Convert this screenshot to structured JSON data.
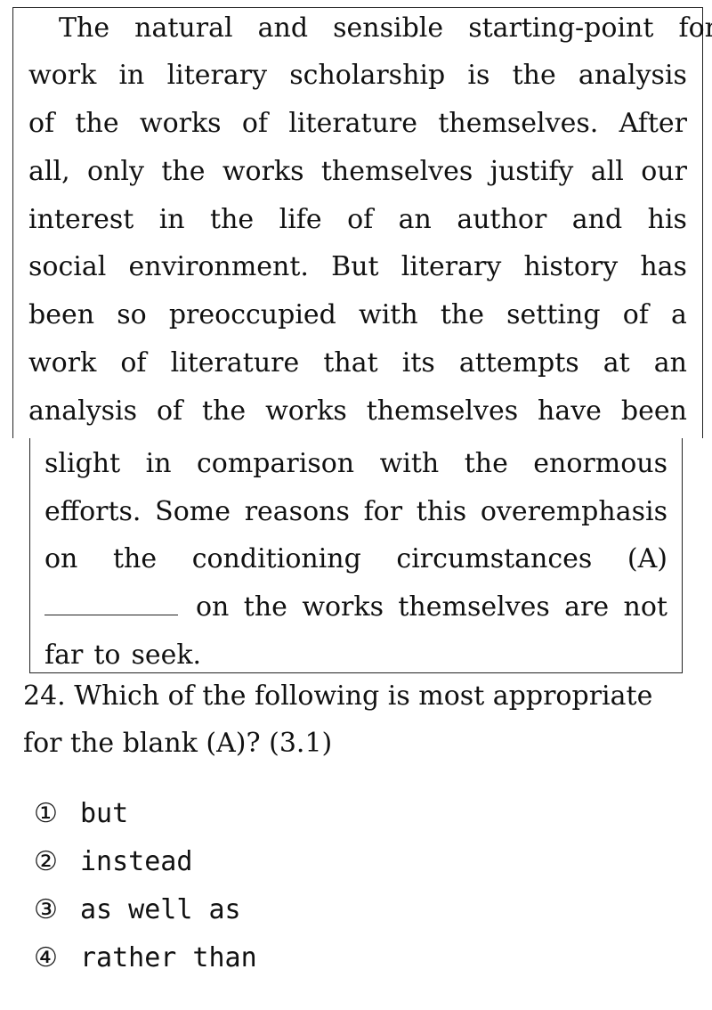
{
  "passage": {
    "lines": [
      [
        "The",
        "natural",
        "and",
        "sensible",
        "starting-point",
        "for"
      ],
      [
        "work",
        "in",
        "literary",
        "scholarship",
        "is",
        "the",
        "analysis"
      ],
      [
        "of",
        "the",
        "works",
        "of",
        "literature",
        "themselves.",
        "After"
      ],
      [
        "all,",
        "only",
        "the",
        "works",
        "themselves",
        "justify",
        "all",
        "our"
      ],
      [
        "interest",
        "in",
        "the",
        "life",
        "of",
        "an",
        "author",
        "and",
        "his"
      ],
      [
        "social",
        "environment.",
        "But",
        "literary",
        "history",
        "has"
      ],
      [
        "been",
        "so",
        "preoccupied",
        "with",
        "the",
        "setting",
        "of",
        "a"
      ],
      [
        "work",
        "of",
        "literature",
        "that",
        "its",
        "attempts",
        "at",
        "an"
      ],
      [
        "analysis",
        "of",
        "the",
        "works",
        "themselves",
        "have",
        "been"
      ],
      [
        "slight",
        "in",
        "comparison",
        "with",
        "the",
        "enormous"
      ],
      [
        "efforts.",
        "Some",
        "reasons",
        "for",
        "this",
        "overemphasis"
      ],
      [
        "on",
        "the",
        "conditioning",
        "circumstances",
        "(A)"
      ],
      [
        "on",
        "the",
        "works",
        "themselves",
        "are",
        "not"
      ],
      [
        "far",
        "to",
        "seek."
      ]
    ]
  },
  "question": {
    "line1": "24. Which of the following is most appropriate",
    "line2": "for the blank (A)? (3.1)"
  },
  "options": [
    {
      "num": "①",
      "text": "but"
    },
    {
      "num": "②",
      "text": "instead"
    },
    {
      "num": "③",
      "text": "as well as"
    },
    {
      "num": "④",
      "text": "rather than"
    }
  ]
}
